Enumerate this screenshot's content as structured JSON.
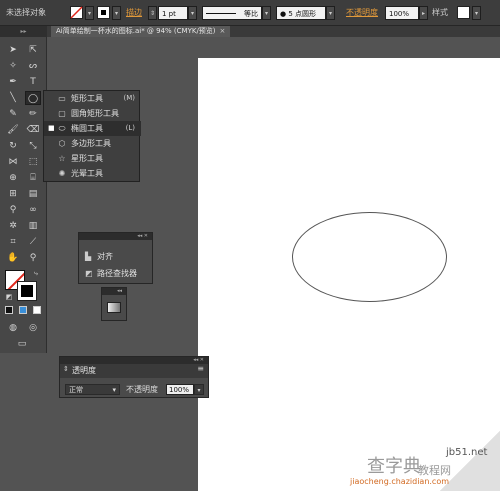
{
  "control_bar": {
    "selection_status": "未选择对象",
    "stroke_label": "描边",
    "stroke_weight": "1 pt",
    "profile_label": "等比",
    "brush_label": "5 点圆形",
    "opacity_label": "不透明度",
    "opacity_value": "100%",
    "style_label": "样式"
  },
  "tab": {
    "title": "Ai简单绘制一杯水的图标.ai* @ 94% (CMYK/预览)",
    "close_glyph": "×"
  },
  "tool_flyout": {
    "items": [
      {
        "label": "矩形工具",
        "shortcut": "(M)",
        "icon": "rectangle-icon",
        "selected": false,
        "glyph": "▭"
      },
      {
        "label": "圆角矩形工具",
        "shortcut": "",
        "icon": "rounded-rectangle-icon",
        "selected": false,
        "glyph": "▢"
      },
      {
        "label": "椭圆工具",
        "shortcut": "(L)",
        "icon": "ellipse-icon",
        "selected": true,
        "glyph": "⬭"
      },
      {
        "label": "多边形工具",
        "shortcut": "",
        "icon": "polygon-icon",
        "selected": false,
        "glyph": "⬡"
      },
      {
        "label": "星形工具",
        "shortcut": "",
        "icon": "star-icon",
        "selected": false,
        "glyph": "☆"
      },
      {
        "label": "光晕工具",
        "shortcut": "",
        "icon": "flare-icon",
        "selected": false,
        "glyph": "✺"
      }
    ]
  },
  "align_panel": {
    "items": [
      {
        "label": "对齐",
        "icon": "align-icon",
        "glyph": "▙"
      },
      {
        "label": "路径查找器",
        "icon": "pathfinder-icon",
        "glyph": "◩"
      }
    ]
  },
  "transparency_panel": {
    "title": "透明度",
    "blend_mode": "正常",
    "opacity_label": "不透明度",
    "opacity_value": "100%"
  },
  "watermark": {
    "line1": "查字典",
    "line2": "教程网",
    "line3": "jiaocheng.chazidian.com",
    "corner_text": "jb51.net"
  },
  "colors": {
    "ui_dark": "#3d3d3d",
    "canvas_bg": "#535353",
    "artboard": "#ffffff",
    "accent_orange": "#e39a3a",
    "fill_none_red": "#e0261b"
  }
}
